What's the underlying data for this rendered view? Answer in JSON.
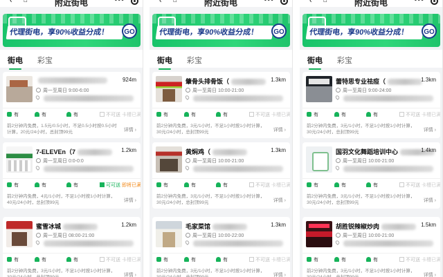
{
  "header": {
    "title": "附近街电"
  },
  "banner": {
    "slogan": "代理街电，享90%收益分成！",
    "go_label": "GO"
  },
  "tabs": [
    {
      "label": "街电"
    },
    {
      "label": "彩宝"
    }
  ],
  "labels": {
    "available": "有",
    "wireless_off": "不可送",
    "wireless_on": "可可送",
    "rent_sub": "即将已满",
    "full_sub": "卡槽已满",
    "detail": "详情"
  },
  "panels": [
    {
      "stores": [
        {
          "name": "",
          "distance": "924m",
          "hours": "周一至周日 9:00-6:00",
          "thumb": "th-a",
          "wireless": false,
          "price": "前2分钟内免费，1.5元/0.5小时，不足0.5小时按0.5小时计算，20元/24小时，总封顶99元"
        },
        {
          "name": "7-ELEVEn（7",
          "distance": "1.2km",
          "hours": "周一至周日 0:0-0:0",
          "thumb": "th-b",
          "wireless": true,
          "price": "前2分钟内免费，4元/1小时，不足1小时按1小时计算，40元/24小时，总封顶99元"
        },
        {
          "name": "蜜雪冰城",
          "distance": "1.2km",
          "hours": "周一至周日 08:00-21:00",
          "thumb": "th-c",
          "wireless": false,
          "price": "前2分钟内免费，3元/1小时，不足1小时按1小时计算，30元/24小时，总封顶99元"
        }
      ]
    },
    {
      "stores": [
        {
          "name": "肇骨头排骨饭（",
          "distance": "1.3km",
          "hours": "周一至周日 10:00-21:00",
          "thumb": "th-d",
          "wireless": false,
          "price": "前2分钟内免费，3元/1小时，不足1小时按1小时计算，30元/24小时，总封顶99元"
        },
        {
          "name": "黄焖鸡（",
          "distance": "1.3km",
          "hours": "周一至周日 10:00-21:00",
          "thumb": "th-e",
          "wireless": false,
          "price": "前2分钟内免费，3元/1小时，不足1小时按1小时计算，30元/24小时，总封顶99元"
        },
        {
          "name": "毛家菜馆",
          "distance": "1.3km",
          "hours": "周一至周日 10:00-22:00",
          "thumb": "th-f",
          "wireless": false,
          "price": "前2分钟内免费，3元/1小时，不足1小时按1小时计算，30元/24小时，总封顶99元"
        }
      ]
    },
    {
      "stores": [
        {
          "name": "蕾特思专业祛痘（",
          "distance": "1.3km",
          "hours": "周一至周日 9:00-24:00",
          "thumb": "th-g",
          "wireless": false,
          "price": "前2分钟内免费，3元/1小时，不足1小时按1小时计算，30元/24小时，总封顶99元"
        },
        {
          "name": "国羽文化舞蹈培训中心",
          "distance": "1.4km",
          "hours": "周一至周日 10:00-21:00",
          "thumb": "th-h",
          "wireless": false,
          "price": "前2分钟内免费，3元/1小时，不足1小时按1小时计算，30元/24小时，总封顶99元"
        },
        {
          "name": "胡胜锐辣椒炒肉",
          "distance": "1.5km",
          "hours": "周一至周日 10:00-21:00",
          "thumb": "th-i",
          "wireless": false,
          "price": "前2分钟内免费，3元/1小时，不足1小时按1小时计算，30元/24小时，总封顶99元"
        }
      ]
    }
  ]
}
